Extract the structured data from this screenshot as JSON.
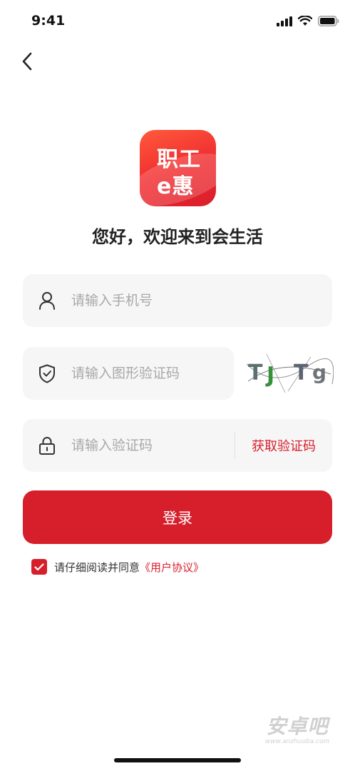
{
  "status_bar": {
    "time": "9:41",
    "icons": [
      "signal-icon",
      "wifi-icon",
      "battery-icon"
    ]
  },
  "header": {
    "back_icon": "chevron-left-icon"
  },
  "logo": {
    "line1": "职工",
    "line2": "e惠",
    "colors": {
      "top": "#ff5a3c",
      "bottom": "#d81e2c"
    }
  },
  "welcome_text": "您好，欢迎来到会生活",
  "form": {
    "phone": {
      "placeholder": "请输入手机号",
      "value": "",
      "icon": "user-icon"
    },
    "captcha": {
      "placeholder": "请输入图形验证码",
      "value": "",
      "icon": "shield-check-icon",
      "captcha_text": "TJTg"
    },
    "sms_code": {
      "placeholder": "请输入验证码",
      "value": "",
      "icon": "lock-icon",
      "get_code_label": "获取验证码"
    }
  },
  "login_button": {
    "label": "登录"
  },
  "agreement": {
    "checked": true,
    "text": "请仔细阅读并同意",
    "link_text": "《用户协议》"
  },
  "watermark": {
    "main": "安卓吧",
    "sub": "www.anzhuoba.com"
  },
  "colors": {
    "accent": "#d61f2b",
    "field_bg": "#f6f6f6",
    "placeholder": "#a8a8a8"
  }
}
